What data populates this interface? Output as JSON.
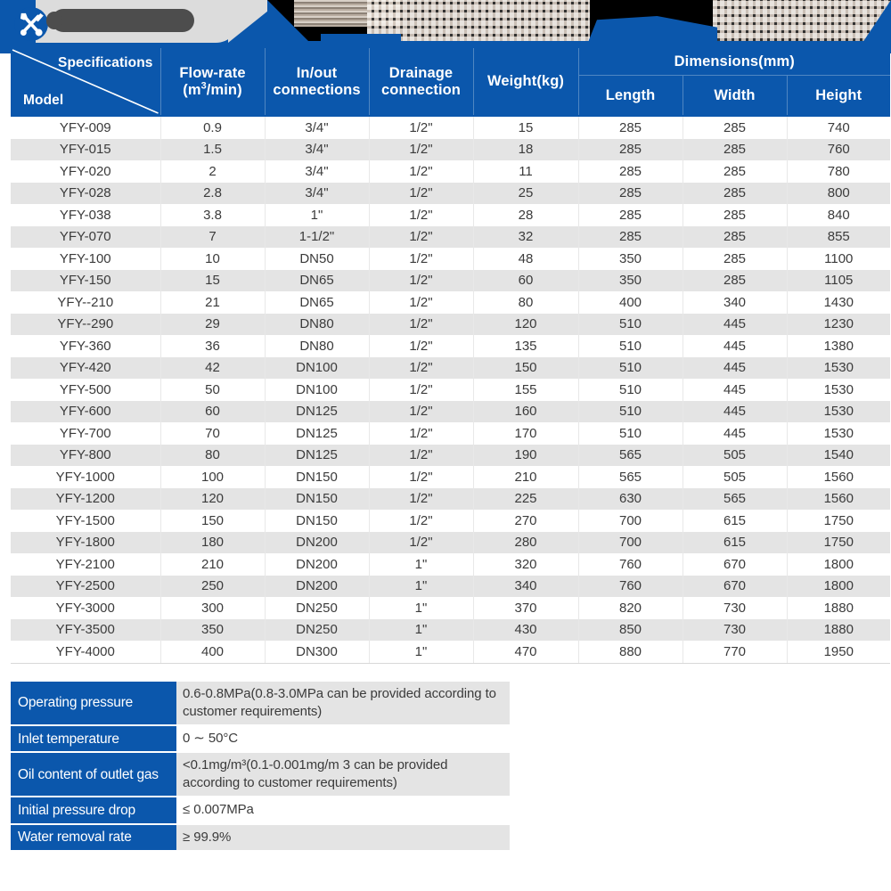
{
  "branding": {
    "logo_icon": "wrench-screwdriver-icon",
    "redacted_label": "",
    "banner_note": "pixelated-product-photo-strip"
  },
  "colors": {
    "header_blue": "#0b57ac",
    "row_alt_grey": "#e4e4e4",
    "row_base": "#ffffff",
    "text_dark": "#3b3b3b",
    "header_text": "#ffffff"
  },
  "main_table": {
    "corner": {
      "spec_label": "Specifications",
      "model_label": "Model"
    },
    "columns": [
      "Flow-rate\n(m³/min)",
      "In/out\nconnections",
      "Drainage\nconnection",
      "Weight(kg)"
    ],
    "col_flow_line1": "Flow-rate",
    "col_flow_line2_pre": "(m",
    "col_flow_line2_sup": "3",
    "col_flow_line2_post": "/min)",
    "col_inout_line1": "In/out",
    "col_inout_line2": "connections",
    "col_drain_line1": "Drainage",
    "col_drain_line2": "connection",
    "col_weight": "Weight(kg)",
    "dimensions_group": "Dimensions(mm)",
    "dim_length": "Length",
    "dim_width": "Width",
    "dim_height": "Height",
    "rows": [
      {
        "model": "YFY-009",
        "flow": "0.9",
        "inout": "3/4\"",
        "drain": "1/2\"",
        "weight": "15",
        "length": "285",
        "width": "285",
        "height": "740"
      },
      {
        "model": "YFY-015",
        "flow": "1.5",
        "inout": "3/4\"",
        "drain": "1/2\"",
        "weight": "18",
        "length": "285",
        "width": "285",
        "height": "760"
      },
      {
        "model": "YFY-020",
        "flow": "2",
        "inout": "3/4\"",
        "drain": "1/2\"",
        "weight": "11",
        "length": "285",
        "width": "285",
        "height": "780"
      },
      {
        "model": "YFY-028",
        "flow": "2.8",
        "inout": "3/4\"",
        "drain": "1/2\"",
        "weight": "25",
        "length": "285",
        "width": "285",
        "height": "800"
      },
      {
        "model": "YFY-038",
        "flow": "3.8",
        "inout": "1\"",
        "drain": "1/2\"",
        "weight": "28",
        "length": "285",
        "width": "285",
        "height": "840"
      },
      {
        "model": "YFY-070",
        "flow": "7",
        "inout": "1-1/2\"",
        "drain": "1/2\"",
        "weight": "32",
        "length": "285",
        "width": "285",
        "height": "855"
      },
      {
        "model": "YFY-100",
        "flow": "10",
        "inout": "DN50",
        "drain": "1/2\"",
        "weight": "48",
        "length": "350",
        "width": "285",
        "height": "1100"
      },
      {
        "model": "YFY-150",
        "flow": "15",
        "inout": "DN65",
        "drain": "1/2\"",
        "weight": "60",
        "length": "350",
        "width": "285",
        "height": "1105"
      },
      {
        "model": "YFY--210",
        "flow": "21",
        "inout": "DN65",
        "drain": "1/2\"",
        "weight": "80",
        "length": "400",
        "width": "340",
        "height": "1430"
      },
      {
        "model": "YFY--290",
        "flow": "29",
        "inout": "DN80",
        "drain": "1/2\"",
        "weight": "120",
        "length": "510",
        "width": "445",
        "height": "1230"
      },
      {
        "model": "YFY-360",
        "flow": "36",
        "inout": "DN80",
        "drain": "1/2\"",
        "weight": "135",
        "length": "510",
        "width": "445",
        "height": "1380"
      },
      {
        "model": "YFY-420",
        "flow": "42",
        "inout": "DN100",
        "drain": "1/2\"",
        "weight": "150",
        "length": "510",
        "width": "445",
        "height": "1530"
      },
      {
        "model": "YFY-500",
        "flow": "50",
        "inout": "DN100",
        "drain": "1/2\"",
        "weight": "155",
        "length": "510",
        "width": "445",
        "height": "1530"
      },
      {
        "model": "YFY-600",
        "flow": "60",
        "inout": "DN125",
        "drain": "1/2\"",
        "weight": "160",
        "length": "510",
        "width": "445",
        "height": "1530"
      },
      {
        "model": "YFY-700",
        "flow": "70",
        "inout": "DN125",
        "drain": "1/2\"",
        "weight": "170",
        "length": "510",
        "width": "445",
        "height": "1530"
      },
      {
        "model": "YFY-800",
        "flow": "80",
        "inout": "DN125",
        "drain": "1/2\"",
        "weight": "190",
        "length": "565",
        "width": "505",
        "height": "1540"
      },
      {
        "model": "YFY-1000",
        "flow": "100",
        "inout": "DN150",
        "drain": "1/2\"",
        "weight": "210",
        "length": "565",
        "width": "505",
        "height": "1560"
      },
      {
        "model": "YFY-1200",
        "flow": "120",
        "inout": "DN150",
        "drain": "1/2\"",
        "weight": "225",
        "length": "630",
        "width": "565",
        "height": "1560"
      },
      {
        "model": "YFY-1500",
        "flow": "150",
        "inout": "DN150",
        "drain": "1/2\"",
        "weight": "270",
        "length": "700",
        "width": "615",
        "height": "1750"
      },
      {
        "model": "YFY-1800",
        "flow": "180",
        "inout": "DN200",
        "drain": "1/2\"",
        "weight": "280",
        "length": "700",
        "width": "615",
        "height": "1750"
      },
      {
        "model": "YFY-2100",
        "flow": "210",
        "inout": "DN200",
        "drain": "1\"",
        "weight": "320",
        "length": "760",
        "width": "670",
        "height": "1800"
      },
      {
        "model": "YFY-2500",
        "flow": "250",
        "inout": "DN200",
        "drain": "1\"",
        "weight": "340",
        "length": "760",
        "width": "670",
        "height": "1800"
      },
      {
        "model": "YFY-3000",
        "flow": "300",
        "inout": "DN250",
        "drain": "1\"",
        "weight": "370",
        "length": "820",
        "width": "730",
        "height": "1880"
      },
      {
        "model": "YFY-3500",
        "flow": "350",
        "inout": "DN250",
        "drain": "1\"",
        "weight": "430",
        "length": "850",
        "width": "730",
        "height": "1880"
      },
      {
        "model": "YFY-4000",
        "flow": "400",
        "inout": "DN300",
        "drain": "1\"",
        "weight": "470",
        "length": "880",
        "width": "770",
        "height": "1950"
      }
    ]
  },
  "param_table": {
    "rows": [
      {
        "name": "Operating pressure",
        "value": "0.6-0.8MPa(0.8-3.0MPa can be provided according to customer requirements)"
      },
      {
        "name": "Inlet temperature",
        "value": "0 ∼ 50°C"
      },
      {
        "name": "Oil content of outlet gas",
        "value": "<0.1mg/m³(0.1-0.001mg/m 3 can be provided according to customer requirements)"
      },
      {
        "name": "Initial pressure drop",
        "value": "≤ 0.007MPa"
      },
      {
        "name": "Water removal rate",
        "value": "≥ 99.9%"
      }
    ]
  }
}
